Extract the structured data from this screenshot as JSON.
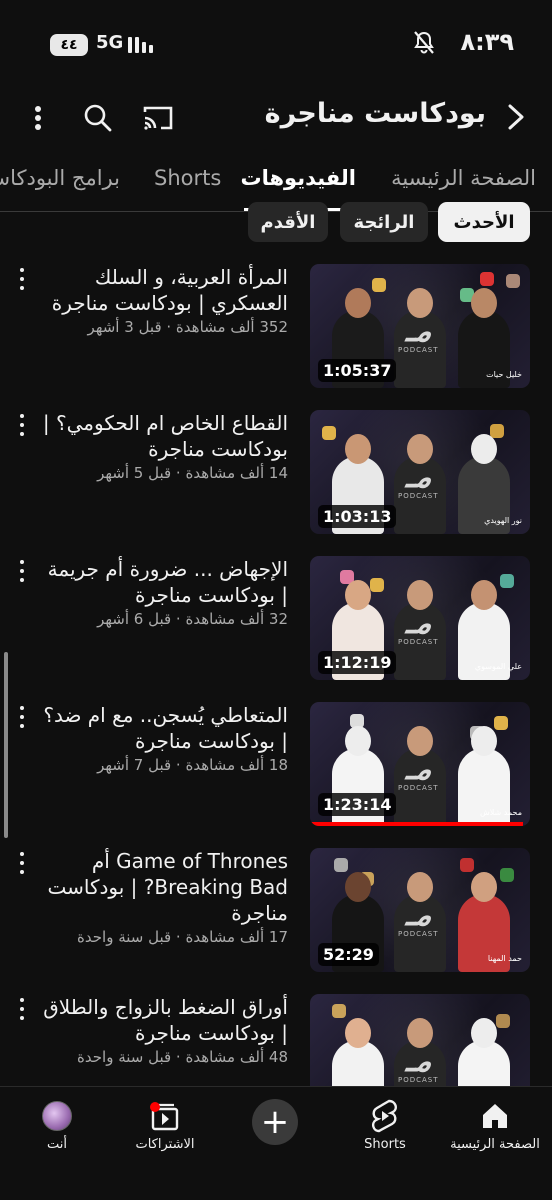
{
  "status_bar": {
    "time": "٨:٣٩",
    "battery": "٤٤",
    "network": "5G",
    "icons": [
      "mute-bell-icon",
      "signal-icon"
    ]
  },
  "header": {
    "channel_name": "بودكاست مناجرة",
    "icons": [
      "back-arrow-icon",
      "cast-icon",
      "search-icon",
      "more-vertical-icon"
    ]
  },
  "tabs": [
    {
      "label": "الصفحة الرئيسية",
      "active": false
    },
    {
      "label": "الفيديوهات",
      "active": true
    },
    {
      "label": "Shorts",
      "active": false
    },
    {
      "label": "برامج البودكاست",
      "active": false
    }
  ],
  "chips": [
    {
      "label": "الأحدث",
      "selected": true
    },
    {
      "label": "الرائجة",
      "selected": false
    },
    {
      "label": "الأقدم",
      "selected": false
    }
  ],
  "videos": [
    {
      "title": "المرأة العربية، و السلك العسكري | بودكاست مناجرة",
      "views": "352 ألف مشاهدة",
      "age": "قبل 3 أشهر",
      "meta": "352 ألف مشاهدة · قبل 3 أشهر",
      "duration": "1:05:37",
      "guest_tag": "خليل حيات",
      "watched": 0
    },
    {
      "title": "القطاع الخاص ام الحكومي؟ | بودكاست مناجرة",
      "views": "14 ألف مشاهدة",
      "age": "قبل 5 أشهر",
      "meta": "14 ألف مشاهدة · قبل 5 أشهر",
      "duration": "1:03:13",
      "guest_tag": "نور الهويدي",
      "watched": 0
    },
    {
      "title": "الإجهاض ... ضرورة أم جريمة | بودكاست مناجرة",
      "views": "32 ألف مشاهدة",
      "age": "قبل 6 أشهر",
      "meta": "32 ألف مشاهدة · قبل 6 أشهر",
      "duration": "1:12:19",
      "guest_tag": "علي الموسوي",
      "watched": 0
    },
    {
      "title": "المتعاطي يُسجن.. مع ام ضد؟ | بودكاست مناجرة",
      "views": "18 ألف مشاهدة",
      "age": "قبل 7 أشهر",
      "meta": "18 ألف مشاهدة · قبل 7 أشهر",
      "duration": "1:23:14",
      "guest_tag": "محمد شلاش",
      "watched": 0.97
    },
    {
      "title": "Game of Thrones أم Breaking Bad? | بودكاست مناجرة",
      "views": "17 ألف مشاهدة",
      "age": "قبل سنة واحدة",
      "meta": "17 ألف مشاهدة · قبل سنة واحدة",
      "duration": "52:29",
      "guest_tag": "حمد المهنا",
      "watched": 0
    },
    {
      "title": "أوراق الضغط بالزواج والطلاق | بودكاست مناجرة",
      "views": "48 ألف مشاهدة",
      "age": "قبل سنة واحدة",
      "meta": "48 ألف مشاهدة · قبل سنة واحدة",
      "duration": "",
      "guest_tag": "",
      "watched": 0
    }
  ],
  "bottom_nav": [
    {
      "label": "الصفحة الرئيسية",
      "icon": "home-icon"
    },
    {
      "label": "Shorts",
      "icon": "shorts-icon"
    },
    {
      "label": "",
      "icon": "plus-icon"
    },
    {
      "label": "الاشتراكات",
      "icon": "subscriptions-icon"
    },
    {
      "label": "أنت",
      "icon": "avatar"
    }
  ],
  "colors": {
    "background": "#0f0f0f",
    "accent_red": "#ff0000",
    "chip_selected": "#f1f1f1",
    "chip_default": "#272727"
  }
}
